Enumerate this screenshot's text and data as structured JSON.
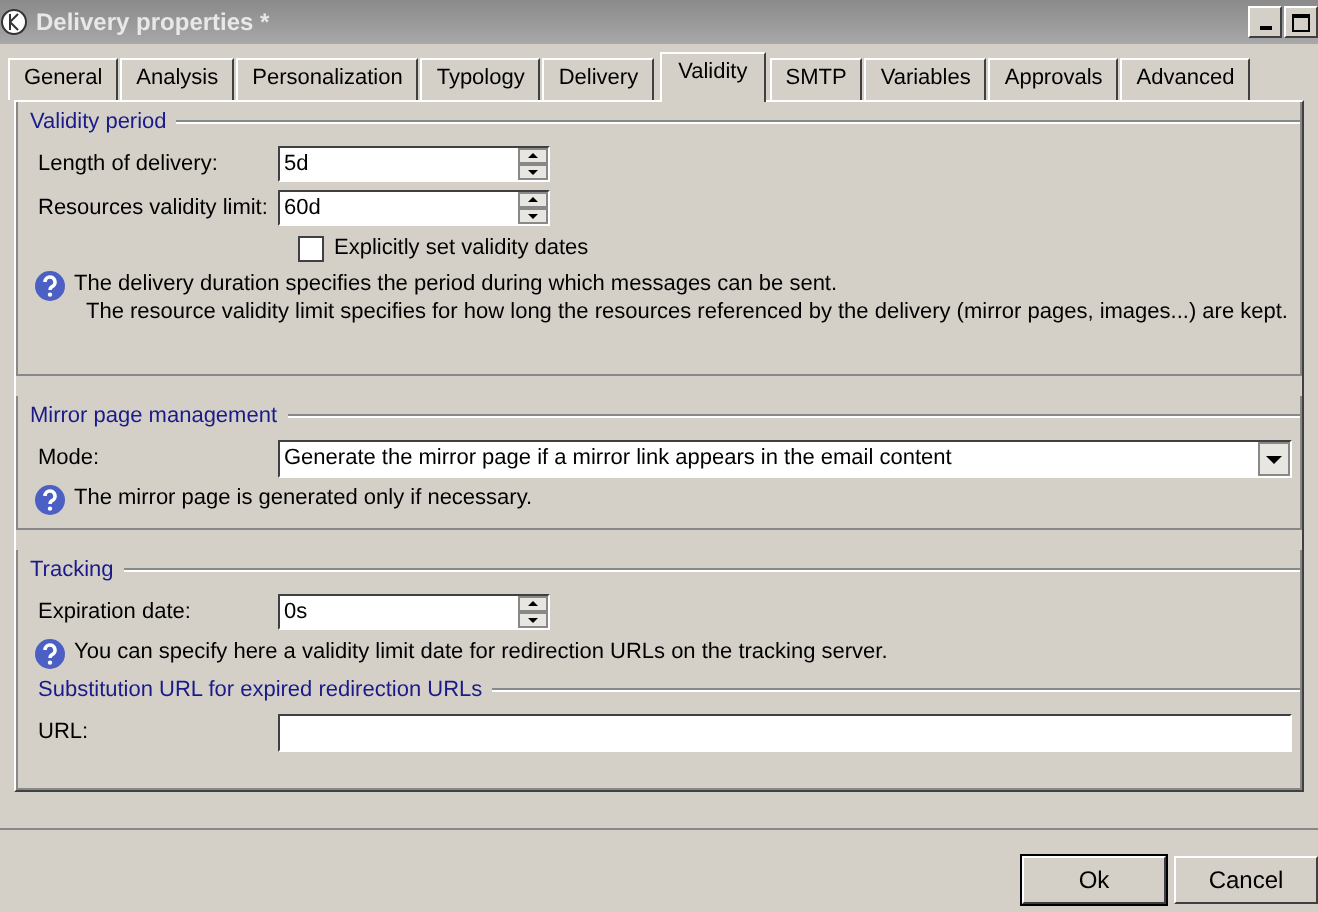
{
  "window": {
    "title": "Delivery properties *"
  },
  "tabs": [
    {
      "label": "General",
      "selected": false
    },
    {
      "label": "Analysis",
      "selected": false
    },
    {
      "label": "Personalization",
      "selected": false
    },
    {
      "label": "Typology",
      "selected": false
    },
    {
      "label": "Delivery",
      "selected": false
    },
    {
      "label": "Validity",
      "selected": true
    },
    {
      "label": "SMTP",
      "selected": false
    },
    {
      "label": "Variables",
      "selected": false
    },
    {
      "label": "Approvals",
      "selected": false
    },
    {
      "label": "Advanced",
      "selected": false
    }
  ],
  "validity_period": {
    "title": "Validity period",
    "fields": [
      {
        "label": "Length of delivery:",
        "value": "5d"
      },
      {
        "label": "Resources validity limit:",
        "value": "60d"
      }
    ],
    "checkbox": {
      "label": "Explicitly set validity dates",
      "checked": false
    },
    "help": [
      "The delivery duration specifies the period during which messages can be sent.",
      "The resource validity limit specifies for how long the resources referenced by the delivery (mirror pages, images...) are kept."
    ]
  },
  "mirror_page": {
    "title": "Mirror page management",
    "mode_label": "Mode:",
    "mode_value": "Generate the mirror page if a mirror link appears in the email content",
    "help": "The mirror page is generated only if necessary."
  },
  "tracking": {
    "title": "Tracking",
    "field": {
      "label": "Expiration date:",
      "value": "0s"
    },
    "help": "You can specify here a validity limit date for redirection URLs on the tracking server.",
    "subsection": "Substitution URL for expired redirection URLs",
    "url_label": "URL:"
  },
  "buttons": [
    "Ok",
    "Cancel"
  ]
}
